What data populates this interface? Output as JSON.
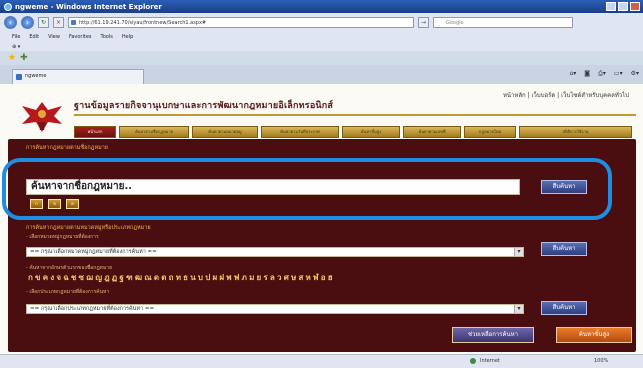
{
  "browser": {
    "title": "ngweme - Windows Internet Explorer",
    "url": "http://61.19.241.70/siyau/frontnew/Search1.aspx#",
    "search_placeholder": "Google",
    "menu": [
      "File",
      "Edit",
      "View",
      "Favorites",
      "Tools",
      "Help"
    ],
    "tab_label": "ngweme",
    "status_zone": "Internet",
    "zoom": "100%"
  },
  "page": {
    "top_links": "หน้าหลัก | เว็บบอร์ด | เว็บไซต์สำหรับบุคคลทั่วไป",
    "site_title": "ฐานข้อมูลรายกิจจานุเบกษาและการพัฒนากฎหมายอิเล็กทรอนิกส์",
    "nav_tabs": [
      "หน้าแรก",
      "ค้นหาตามชื่อกฎหมาย",
      "ค้นหาตามหมวดหมู่",
      "ค้นหาตามวันที่ประกาศ",
      "ค้นหาขั้นสูง",
      "ค้นหาตามเลขที่",
      "กฎหมายใหม่",
      "สถิติการใช้งาน"
    ],
    "section1_title": "การค้นหากฎหมายตามชื่อกฎหมาย",
    "main_input_value": "ค้นหาจากชื่อกฎหมาย..",
    "mini_buttons": [
      "ก",
      "ข",
      "ค"
    ],
    "search_label": "สืบค้นหา",
    "section2_title": "การค้นหากฎหมายตามหมวดหมู่หรือประเภทกฎหมาย",
    "section2_sub": "- เลือกหมวดหมู่กฎหมายที่ต้องการ",
    "select1": "== กรุณาเลือกหมวดหมู่กฎหมายที่ต้องการค้นหา ==",
    "section3_sub": "- ค้นหาจากอักษรตัวแรกของชื่อกฎหมาย",
    "chars": "กขคงจฉชซฌญฎฏฐฑฒณดตถทธนบปผฝพฟภมยรลวศษสหฬอฮ",
    "section4_sub": "- เลือกประเภทกฎหมายที่ต้องการค้นหา",
    "select2": "== กรุณาเลือกประเภทกฎหมายที่ต้องการค้นหา ==",
    "btn_advanced": "ช่วยเหลือการค้นหา",
    "btn_adv_search": "ค้นหาขั้นสูง"
  }
}
